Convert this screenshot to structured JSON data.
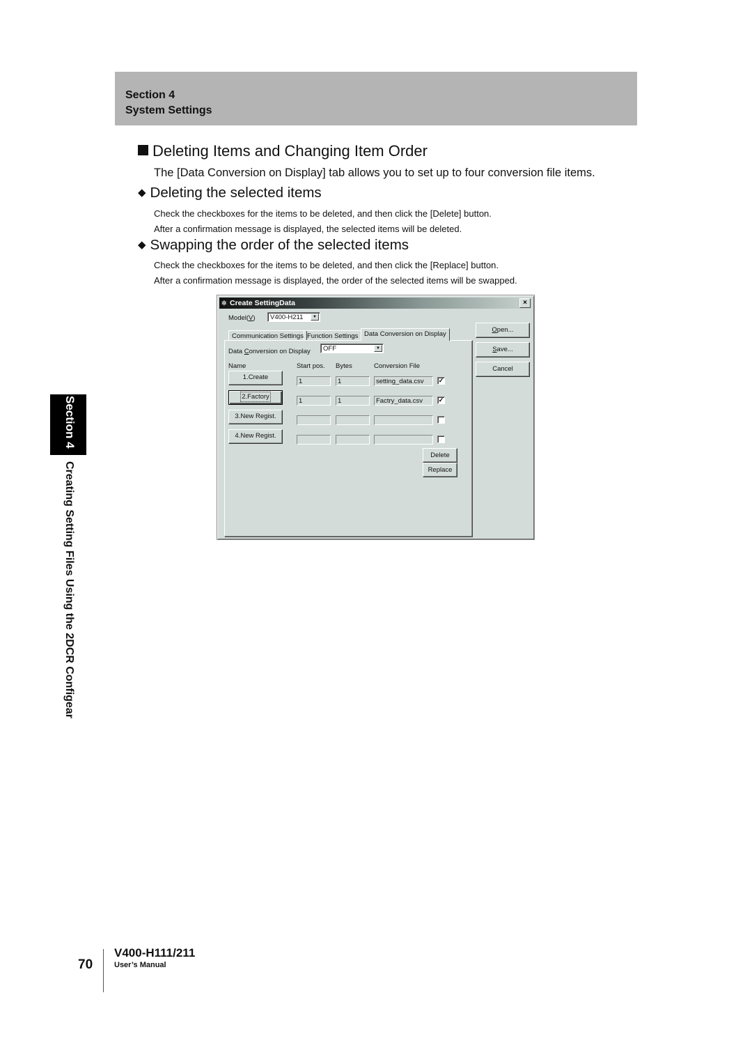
{
  "header": {
    "section": "Section 4",
    "title": "System Settings"
  },
  "main": {
    "heading": "Deleting Items and Changing Item Order",
    "intro": "The [Data Conversion on Display] tab allows you to set up to four conversion file items.",
    "subsections": [
      {
        "heading": "Deleting the selected items",
        "lines": [
          "Check the checkboxes for the items to be deleted, and then click the [Delete] button.",
          "After a confirmation message is displayed, the selected items will be deleted."
        ]
      },
      {
        "heading": "Swapping the order of the selected items",
        "lines": [
          "Check the checkboxes for the items to be deleted, and then click the [Replace] button.",
          "After a confirmation message is displayed, the order of the selected items will be swapped."
        ]
      }
    ]
  },
  "dialog": {
    "title": "Create SettingData",
    "close_glyph": "×",
    "model_label_pre": "Model(",
    "model_label_key": "V",
    "model_label_post": ")",
    "model_value": "V400-H211",
    "tabs": [
      "Communication Settings",
      "Function Settings",
      "Data Conversion on Display"
    ],
    "active_tab": "Data Conversion on Display",
    "dcd_label_pre": "Data ",
    "dcd_label_key": "C",
    "dcd_label_post": "onversion on Display",
    "dcd_value": "OFF",
    "columns": [
      "Name",
      "Start pos.",
      "Bytes",
      "Conversion File"
    ],
    "rows": [
      {
        "name": "1.Create",
        "start": "1",
        "bytes": "1",
        "file": "setting_data.csv",
        "checked": true
      },
      {
        "name": "2.Factory",
        "start": "1",
        "bytes": "1",
        "file": "Factry_data.csv",
        "checked": true
      },
      {
        "name": "3.New Regist.",
        "start": "",
        "bytes": "",
        "file": "",
        "checked": false
      },
      {
        "name": "4.New Regist.",
        "start": "",
        "bytes": "",
        "file": "",
        "checked": false
      }
    ],
    "check_glyph": "✓",
    "delete_label": "Delete",
    "replace_label": "Replace",
    "open_key": "O",
    "open_rest": "pen...",
    "save_key": "S",
    "save_rest": "ave...",
    "cancel_label": "Cancel"
  },
  "side": {
    "section": "Section 4",
    "title": "Creating Setting Files Using the 2DCR Configear"
  },
  "footer": {
    "page": "70",
    "model": "V400-H111/211",
    "manual": "User’s Manual"
  }
}
